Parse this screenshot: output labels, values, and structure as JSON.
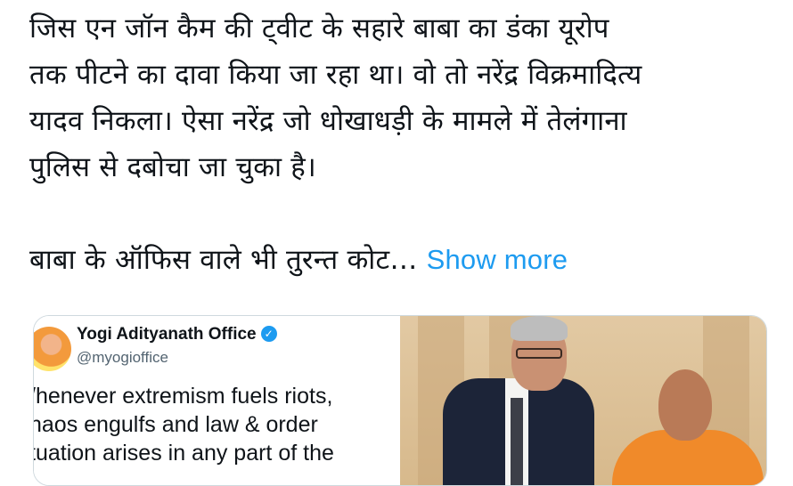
{
  "tweet": {
    "lines": [
      "जिस एन जॉन कैम की ट्वीट के सहारे बाबा का डंका यूरोप",
      "तक पीटने का दावा किया जा रहा था। वो तो नरेंद्र विक्रमादित्य",
      "यादव निकला। ऐसा नरेंद्र जो धोखाधड़ी के मामले में तेलंगाना",
      "पुलिस से दबोचा जा चुका है।"
    ],
    "last_line": "बाबा के ऑफिस वाले भी तुरन्त कोट…",
    "show_more": "Show more"
  },
  "quoted": {
    "name": "Yogi Adityanath Office",
    "handle": "@myogioffice",
    "verified_icon": "verified-badge-icon",
    "body": [
      "/henever extremism fuels riots,",
      "haos engulfs and law & order",
      "tuation arises in any part of the"
    ]
  },
  "colors": {
    "link": "#1d9bf0",
    "text": "#0f1419",
    "secondary": "#536471",
    "border": "#cfd9de"
  }
}
